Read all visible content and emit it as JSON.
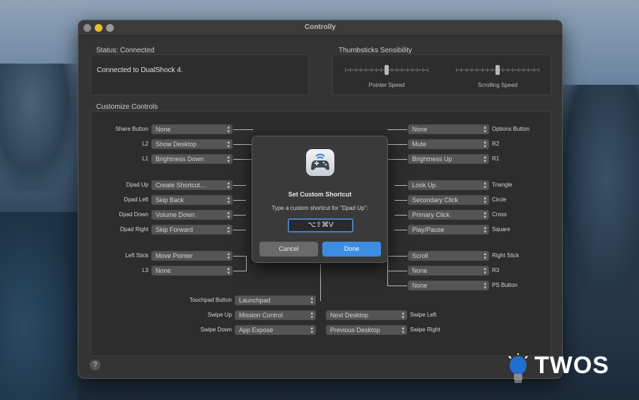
{
  "window": {
    "title": "Controlly"
  },
  "status": {
    "label": "Status: Connected",
    "text": "Connected to DualShock 4."
  },
  "sensibility": {
    "label": "Thumbsticks Sensibility",
    "pointer_label": "Pointer Speed",
    "pointer_value": 0.5,
    "scrolling_label": "Scrolling Speed",
    "scrolling_value": 0.5
  },
  "customize": {
    "label": "Customize Controls",
    "left": [
      {
        "label": "Share Button",
        "value": "None"
      },
      {
        "label": "L2",
        "value": "Show Desktop"
      },
      {
        "label": "L1",
        "value": "Brightness Down"
      },
      {
        "label": "Dpad Up",
        "value": "Create Shortcut..."
      },
      {
        "label": "Dpad Left",
        "value": "Skip Back"
      },
      {
        "label": "Dpad Down",
        "value": "Volume Down"
      },
      {
        "label": "Dpad Right",
        "value": "Skip Forward"
      },
      {
        "label": "Left Stick",
        "value": "Move Pointer"
      },
      {
        "label": "L3",
        "value": "None"
      }
    ],
    "right": [
      {
        "label": "Options Button",
        "value": "None"
      },
      {
        "label": "R2",
        "value": "Mute"
      },
      {
        "label": "R1",
        "value": "Brightness Up"
      },
      {
        "label": "Triangle",
        "value": "Look Up"
      },
      {
        "label": "Circle",
        "value": "Secondary Click"
      },
      {
        "label": "Cross",
        "value": "Primary Click"
      },
      {
        "label": "Square",
        "value": "Play/Pause"
      },
      {
        "label": "Right Stick",
        "value": "Scroll"
      },
      {
        "label": "R3",
        "value": "None"
      },
      {
        "label": "PS Button",
        "value": "None"
      }
    ],
    "touchpad": {
      "button": {
        "label": "Touchpad Button",
        "value": "Launchpad"
      },
      "swipe_up": {
        "label": "Swipe Up",
        "value": "Mission Control"
      },
      "swipe_down": {
        "label": "Swipe Down",
        "value": "App Exposé"
      },
      "swipe_left": {
        "label": "Swipe Left",
        "value": "Next Desktop"
      },
      "swipe_right": {
        "label": "Swipe Right",
        "value": "Previous Desktop"
      }
    }
  },
  "dialog": {
    "title": "Set Custom Shortcut",
    "message": "Type a custom shortcut for \"Dpad Up\":",
    "input_value": "⌥⇧⌘V",
    "cancel_label": "Cancel",
    "done_label": "Done",
    "icon": "gamepad-icon"
  },
  "help_label": "?",
  "watermark": {
    "text": "TWOS",
    "icon": "lightbulb-icon"
  },
  "colors": {
    "accent": "#3d8de3",
    "window_bg": "#343434",
    "traffic_yellow": "#e6c02e"
  }
}
